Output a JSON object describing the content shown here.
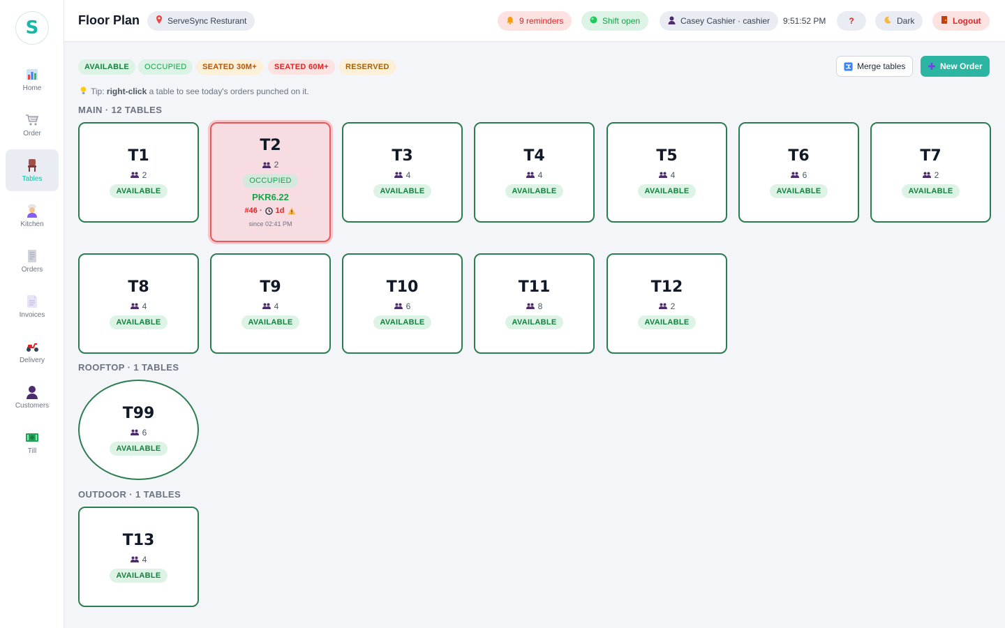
{
  "app": {
    "logo_letter": "S"
  },
  "sidebar": {
    "items": [
      {
        "label": "Home",
        "icon": "bar-chart-icon"
      },
      {
        "label": "Order",
        "icon": "cart-icon"
      },
      {
        "label": "Tables",
        "icon": "chair-icon",
        "active": true
      },
      {
        "label": "Kitchen",
        "icon": "chef-icon"
      },
      {
        "label": "Orders",
        "icon": "receipt-icon"
      },
      {
        "label": "Invoices",
        "icon": "invoice-icon"
      },
      {
        "label": "Delivery",
        "icon": "scooter-icon"
      },
      {
        "label": "Customers",
        "icon": "user-icon"
      },
      {
        "label": "Till",
        "icon": "cash-icon"
      }
    ]
  },
  "header": {
    "title": "Floor Plan",
    "restaurant": "ServeSync Resturant",
    "reminders": "9 reminders",
    "shift": "Shift open",
    "user": "Casey Cashier · cashier",
    "time": "9:51:52 PM",
    "help": "?",
    "theme": "Dark",
    "logout": "Logout"
  },
  "legend": {
    "available": "AVAILABLE",
    "occupied": "OCCUPIED",
    "seated30": "SEATED 30M+",
    "seated60": "SEATED 60M+",
    "reserved": "RESERVED"
  },
  "actions": {
    "merge": "Merge tables",
    "new_order": "New Order"
  },
  "tip": {
    "prefix": "Tip:",
    "bold": "right-click",
    "suffix": "a table to see today's orders punched on it."
  },
  "sections": {
    "main": "MAIN · 12 TABLES",
    "rooftop": "ROOFTOP · 1 TABLES",
    "outdoor": "OUTDOOR · 1 TABLES"
  },
  "tables": {
    "t1": {
      "name": "T1",
      "seats": "2",
      "status": "AVAILABLE"
    },
    "t2": {
      "name": "T2",
      "seats": "2",
      "status": "OCCUPIED",
      "amount": "PKR6.22",
      "order": "#46 ·",
      "duration": "1d",
      "since": "since 02:41 PM"
    },
    "t3": {
      "name": "T3",
      "seats": "4",
      "status": "AVAILABLE"
    },
    "t4": {
      "name": "T4",
      "seats": "4",
      "status": "AVAILABLE"
    },
    "t5": {
      "name": "T5",
      "seats": "4",
      "status": "AVAILABLE"
    },
    "t6": {
      "name": "T6",
      "seats": "6",
      "status": "AVAILABLE"
    },
    "t7": {
      "name": "T7",
      "seats": "2",
      "status": "AVAILABLE"
    },
    "t8": {
      "name": "T8",
      "seats": "4",
      "status": "AVAILABLE"
    },
    "t9": {
      "name": "T9",
      "seats": "4",
      "status": "AVAILABLE"
    },
    "t10": {
      "name": "T10",
      "seats": "6",
      "status": "AVAILABLE"
    },
    "t11": {
      "name": "T11",
      "seats": "8",
      "status": "AVAILABLE"
    },
    "t12": {
      "name": "T12",
      "seats": "2",
      "status": "AVAILABLE"
    },
    "t99": {
      "name": "T99",
      "seats": "6",
      "status": "AVAILABLE"
    },
    "t13": {
      "name": "T13",
      "seats": "4",
      "status": "AVAILABLE"
    }
  },
  "colors": {
    "accent": "#2bb5a2",
    "available_border": "#2a7d4f",
    "occupied_border": "#e55a5a"
  }
}
